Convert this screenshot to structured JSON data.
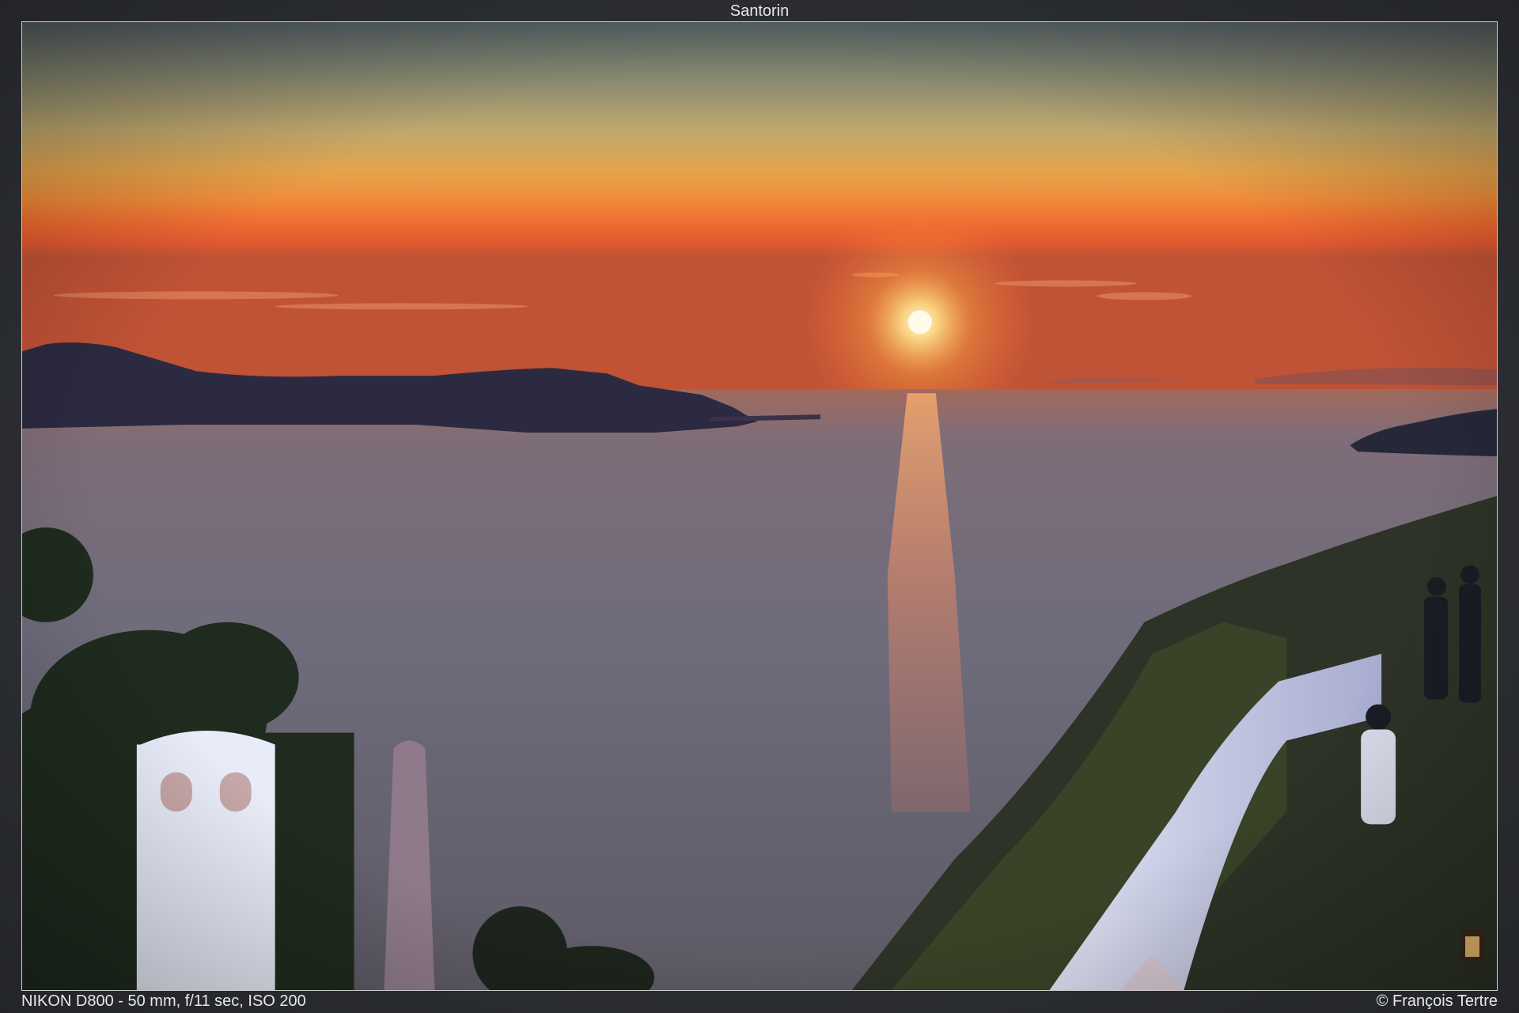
{
  "title": "Santorin",
  "exif": "NIKON D800 - 50 mm, f/11 sec, ISO 200",
  "copyright": "© François Tertre",
  "photo": {
    "subject": "sunset",
    "colors": {
      "sky_top": "#5a6468",
      "sky_mid": "#d89a55",
      "sky_low": "#f08a3c",
      "horizon": "#f06a2e",
      "sun": "#fff6c8",
      "sea": "#6c6a78",
      "land": "#2b2a3a",
      "foliage": "#1e2a1c"
    }
  }
}
